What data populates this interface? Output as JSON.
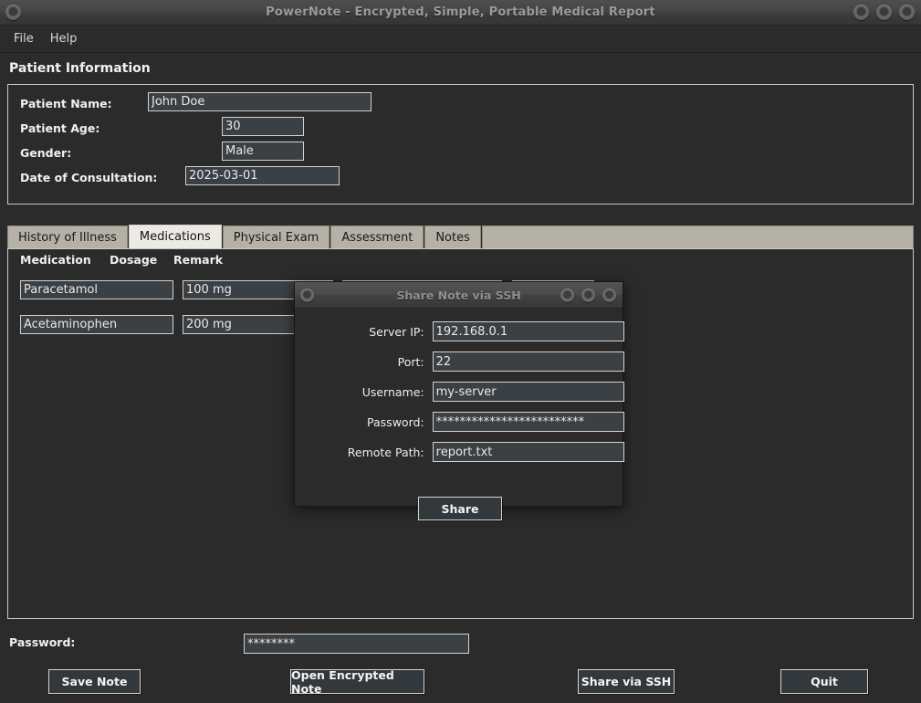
{
  "window": {
    "title": "PowerNote - Encrypted, Simple, Portable Medical Report",
    "controls": {
      "left_icon": "window-menu-icon",
      "minimize_icon": "minimize-icon",
      "maximize_icon": "maximize-icon",
      "close_icon": "close-icon"
    }
  },
  "menubar": {
    "items": [
      {
        "label": "File"
      },
      {
        "label": "Help"
      }
    ]
  },
  "patient_section": {
    "title": "Patient Information",
    "fields": [
      {
        "label": "Patient Name:",
        "value": "John Doe",
        "placeholder": ""
      },
      {
        "label": "Patient Age:",
        "value": "30",
        "placeholder": ""
      },
      {
        "label": "Gender:",
        "value": "Male",
        "placeholder": ""
      },
      {
        "label": "Date of Consultation:",
        "value": "2025-03-01",
        "placeholder": ""
      }
    ]
  },
  "tabs": {
    "active": "Medications",
    "items": [
      {
        "label": "History of Illness"
      },
      {
        "label": "Medications"
      },
      {
        "label": "Physical Exam"
      },
      {
        "label": "Assessment"
      },
      {
        "label": "Notes"
      }
    ]
  },
  "medications": {
    "columns": [
      "Medication",
      "Dosage",
      "Remark"
    ],
    "rows": [
      {
        "medication": "Paracetamol",
        "dosage": "100 mg",
        "remark": ""
      },
      {
        "medication": "Acetaminophen",
        "dosage": "200 mg",
        "remark": ""
      }
    ],
    "remove_label": ""
  },
  "bottom": {
    "password_label": "Password:",
    "password_value": "********",
    "password_placeholder": "",
    "buttons": [
      {
        "label": "Save Note"
      },
      {
        "label": "Open Encrypted Note"
      },
      {
        "label": "Share via SSH"
      },
      {
        "label": "Quit"
      }
    ]
  },
  "dialog": {
    "title": "Share Note via SSH",
    "controls": {
      "left_icon": "window-menu-icon",
      "minimize_icon": "minimize-icon",
      "maximize_icon": "maximize-icon",
      "close_icon": "close-icon"
    },
    "fields": [
      {
        "label": "Server IP:",
        "value": "192.168.0.1",
        "placeholder": ""
      },
      {
        "label": "Port:",
        "value": "22",
        "placeholder": ""
      },
      {
        "label": "Username:",
        "value": "my-server",
        "placeholder": ""
      },
      {
        "label": "Password:",
        "value": "*************************",
        "placeholder": ""
      },
      {
        "label": "Remote Path:",
        "value": "report.txt",
        "placeholder": ""
      }
    ],
    "share_button": "Share"
  },
  "colors": {
    "window_bg": "#2b2b2b",
    "input_bg": "#3b4045",
    "input_border": "#d2d2cd",
    "panel_border": "#c9c9c4",
    "tab_inactive": "#b5b1a6",
    "tab_active": "#eceae4",
    "titlebar_text": "#9b9b9b",
    "text": "#f0f0f0"
  }
}
